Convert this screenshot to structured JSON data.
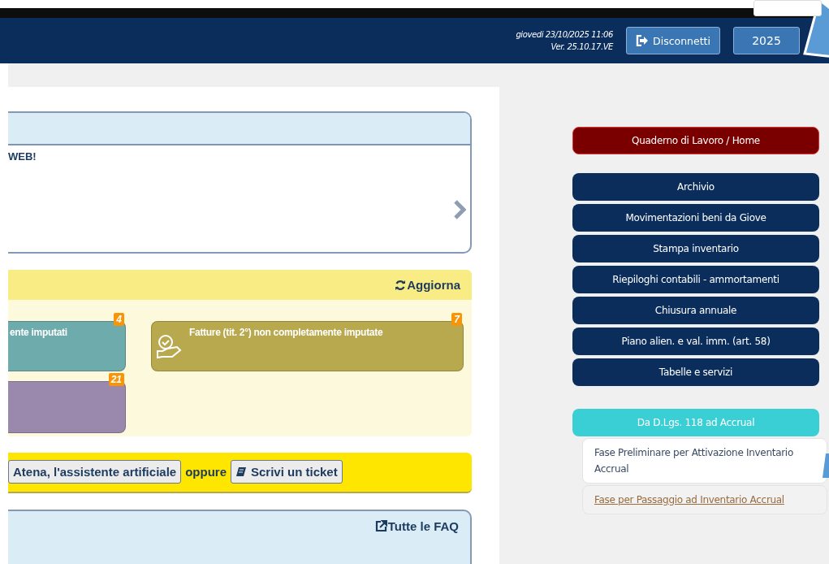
{
  "header": {
    "date": "giovedi 23/10/2025 11:06",
    "version": "Ver. 25.10.17.VE",
    "logout": "Disconnetti",
    "year": "2025"
  },
  "news": {
    "text": "WEB!"
  },
  "tasks": {
    "action": "Aggiorna",
    "tiles": [
      {
        "text": "ente imputati",
        "count": "4",
        "color": "#6eabac",
        "icon": false
      },
      {
        "text": "Fatture (tit. 2°) non completamente imputate",
        "count": "7",
        "color": "#b8a94e",
        "icon": true
      },
      {
        "count": "21",
        "color": "#9a88ad",
        "icon": false
      }
    ]
  },
  "help": {
    "assistant": "Atena, l'assistente artificiale",
    "or": "oppure",
    "ticket": "Scrivi un ticket"
  },
  "faq": {
    "action": "Tutte le FAQ"
  },
  "menu": {
    "home": "Quaderno di Lavoro / Home",
    "items": [
      "Archivio",
      "Movimentazioni beni da Giove",
      "Stampa inventario",
      "Riepiloghi contabili - ammortamenti",
      "Chiusura annuale",
      "Piano alien. e val. imm. (art. 58)",
      "Tabelle e servizi"
    ],
    "accrual": {
      "title": "Da D.Lgs. 118 ad Accrual",
      "items": [
        {
          "label": "Fase Preliminare per Attivazione Inventario Accrual",
          "kind": "text"
        },
        {
          "label": "Fase per Passaggio ad Inventario Accrual",
          "kind": "link"
        }
      ]
    }
  }
}
